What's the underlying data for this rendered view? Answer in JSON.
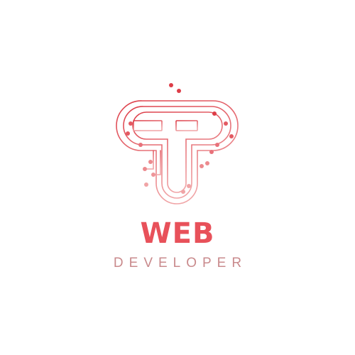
{
  "logo": {
    "title": "WEB",
    "subtitle": "DEVELOPER",
    "colors": {
      "title": "#e8515a",
      "subtitle": "#c98a8c",
      "circuit_dark": "#dd3d48",
      "circuit_light": "#f0a4a6"
    },
    "icon": "circuit-t-emblem"
  }
}
